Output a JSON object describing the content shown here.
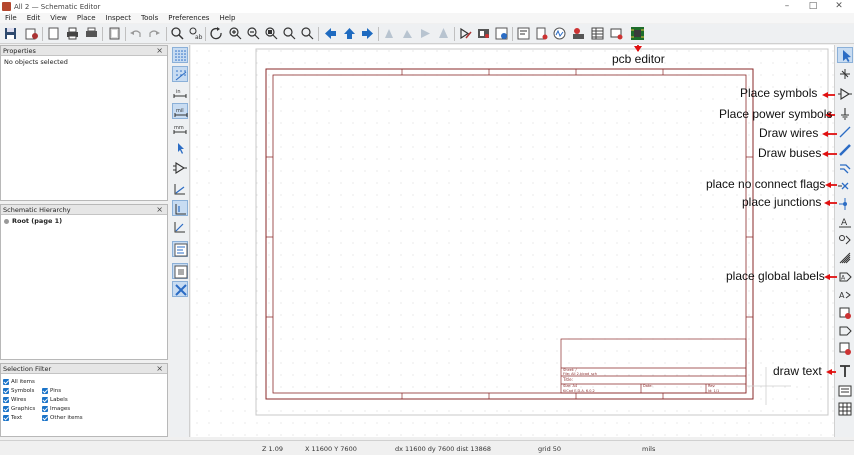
{
  "window": {
    "title": "All 2 — Schematic Editor"
  },
  "menu": [
    "File",
    "Edit",
    "View",
    "Place",
    "Inspect",
    "Tools",
    "Preferences",
    "Help"
  ],
  "panels": {
    "properties": {
      "title": "Properties",
      "empty_text": "No objects selected"
    },
    "hierarchy": {
      "title": "Schematic Hierarchy",
      "root": "Root (page 1)"
    },
    "selection_filter": {
      "title": "Selection Filter",
      "col1": [
        "All items",
        "Symbols",
        "Wires",
        "Graphics",
        "Text"
      ],
      "col2": [
        "Pins",
        "Labels",
        "Images",
        "Other items"
      ]
    }
  },
  "left_toolbar_icons": [
    "grid-icon",
    "overlay-grid-icon",
    "inches-icon",
    "mils-icon",
    "millimeters-icon",
    "cursor-shape-icon",
    "hidden-pins-icon",
    "line-angle-free-icon",
    "line-angle-90-icon",
    "line-angle-45-icon",
    "annotate-icon",
    "hierarchy-navigator-icon",
    "properties-manager-icon"
  ],
  "left_toolbar_labels": {
    "inches": "in",
    "mils": "mil",
    "millimeters": "mm"
  },
  "annotations": {
    "pcb_editor": "pcb editor",
    "place_symbols": "Place symbols",
    "place_power_symbols": "Place power symbols",
    "draw_wires": "Draw wires",
    "draw_buses": "Draw buses",
    "place_no_connect_flags": "place no connect flags",
    "place_junctions": "place junctions",
    "place_global_labels": "place global labels",
    "draw_text": "draw text"
  },
  "title_block": {
    "sheet": "Sheet: /",
    "file": "File: All 2.kicad_sch",
    "title": "Title:",
    "size": "Size: A4",
    "date": "Date:",
    "rev": "Rev:",
    "tool": "KiCad E.D.A.  6.0.2",
    "id": "Id: 1/1"
  },
  "status": {
    "zoom": "Z 1.09",
    "xy": "X 11600  Y 7600",
    "delta": "dx 11600  dy 7600  dist 13868",
    "grid": "grid 50",
    "units": "mils"
  },
  "colors": {
    "sheet_border": "#8a2a2a",
    "annotation_arrow": "#e01010",
    "accent": "#1a73c8"
  }
}
